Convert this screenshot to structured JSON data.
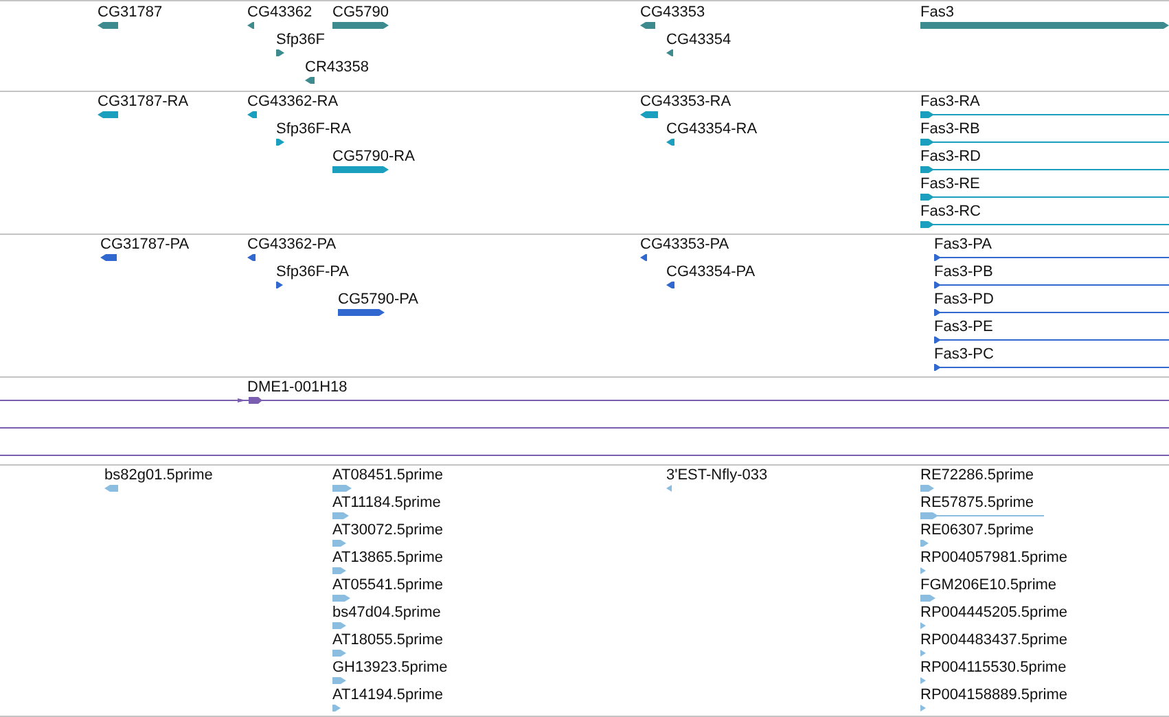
{
  "tracks": [
    {
      "kind": "gene",
      "color": "#3d8b8f",
      "features": [
        {
          "label": "CG31787",
          "reverse": true
        },
        {
          "label": "CG43362",
          "reverse": true
        },
        {
          "label": "CG5790",
          "reverse": false
        },
        {
          "label": "Sfp36F",
          "reverse": false
        },
        {
          "label": "CR43358",
          "reverse": true
        },
        {
          "label": "CG43353",
          "reverse": true
        },
        {
          "label": "CG43354",
          "reverse": true
        },
        {
          "label": "Fas3",
          "reverse": false
        }
      ]
    },
    {
      "kind": "transcript",
      "color": "#1a9fbe",
      "features": [
        {
          "label": "CG31787-RA",
          "reverse": true
        },
        {
          "label": "CG43362-RA",
          "reverse": true
        },
        {
          "label": "Sfp36F-RA",
          "reverse": false
        },
        {
          "label": "CG5790-RA",
          "reverse": false
        },
        {
          "label": "CG43353-RA",
          "reverse": true
        },
        {
          "label": "CG43354-RA",
          "reverse": true
        },
        {
          "label": "Fas3-RA",
          "reverse": false
        },
        {
          "label": "Fas3-RB",
          "reverse": false
        },
        {
          "label": "Fas3-RD",
          "reverse": false
        },
        {
          "label": "Fas3-RE",
          "reverse": false
        },
        {
          "label": "Fas3-RC",
          "reverse": false
        }
      ]
    },
    {
      "kind": "protein",
      "color": "#3068d0",
      "features": [
        {
          "label": "CG31787-PA",
          "reverse": true
        },
        {
          "label": "CG43362-PA",
          "reverse": true
        },
        {
          "label": "Sfp36F-PA",
          "reverse": false
        },
        {
          "label": "CG5790-PA",
          "reverse": false
        },
        {
          "label": "CG43353-PA",
          "reverse": true
        },
        {
          "label": "CG43354-PA",
          "reverse": true
        },
        {
          "label": "Fas3-PA",
          "reverse": false
        },
        {
          "label": "Fas3-PB",
          "reverse": false
        },
        {
          "label": "Fas3-PD",
          "reverse": false
        },
        {
          "label": "Fas3-PE",
          "reverse": false
        },
        {
          "label": "Fas3-PC",
          "reverse": false
        }
      ]
    },
    {
      "kind": "clone",
      "color": "#7a5fb0",
      "features": [
        {
          "label": "DME1-001H18",
          "reverse": false
        }
      ]
    },
    {
      "kind": "est",
      "color": "#8bbde0",
      "features": [
        {
          "label": "bs82g01.5prime",
          "reverse": true
        },
        {
          "label": "AT08451.5prime",
          "reverse": false
        },
        {
          "label": "AT11184.5prime",
          "reverse": false
        },
        {
          "label": "AT30072.5prime",
          "reverse": false
        },
        {
          "label": "AT13865.5prime",
          "reverse": false
        },
        {
          "label": "AT05541.5prime",
          "reverse": false
        },
        {
          "label": "bs47d04.5prime",
          "reverse": false
        },
        {
          "label": "AT18055.5prime",
          "reverse": false
        },
        {
          "label": "GH13923.5prime",
          "reverse": false
        },
        {
          "label": "AT14194.5prime",
          "reverse": false
        },
        {
          "label": "3'EST-Nfly-033",
          "reverse": true
        },
        {
          "label": "RE72286.5prime",
          "reverse": false
        },
        {
          "label": "RE57875.5prime",
          "reverse": false
        },
        {
          "label": "RE06307.5prime",
          "reverse": false
        },
        {
          "label": "RP004057981.5prime",
          "reverse": false
        },
        {
          "label": "FGM206E10.5prime",
          "reverse": false
        },
        {
          "label": "RP004445205.5prime",
          "reverse": false
        },
        {
          "label": "RP004483437.5prime",
          "reverse": false
        },
        {
          "label": "RP004115530.5prime",
          "reverse": false
        },
        {
          "label": "RP004158889.5prime",
          "reverse": false
        }
      ]
    }
  ]
}
